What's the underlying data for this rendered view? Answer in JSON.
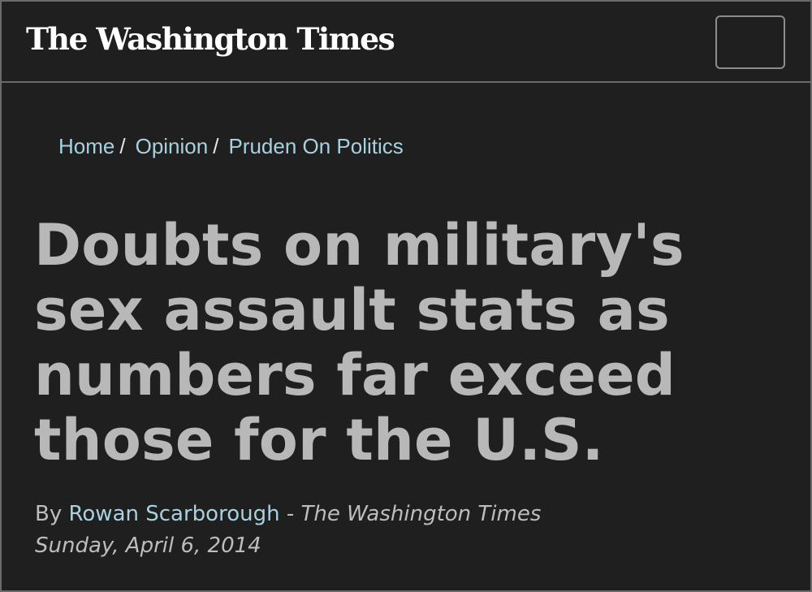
{
  "header": {
    "logo_text": "The Washington Times",
    "menu_button_label": ""
  },
  "breadcrumb": {
    "items": [
      {
        "label": "Home"
      },
      {
        "label": "Opinion"
      },
      {
        "label": "Pruden On Politics"
      }
    ],
    "separator": "/"
  },
  "article": {
    "headline": "Doubts on military's sex assault stats as numbers far exceed those for the U.S.",
    "byline_prefix": "By",
    "author": "Rowan Scarborough",
    "byline_dash": "-",
    "publication": "The Washington Times",
    "date": "Sunday, April 6, 2014"
  },
  "colors": {
    "background": "#1f1f1f",
    "link": "#a8d1e0",
    "headline": "#b8b8b8",
    "border": "#6a6a6a"
  }
}
